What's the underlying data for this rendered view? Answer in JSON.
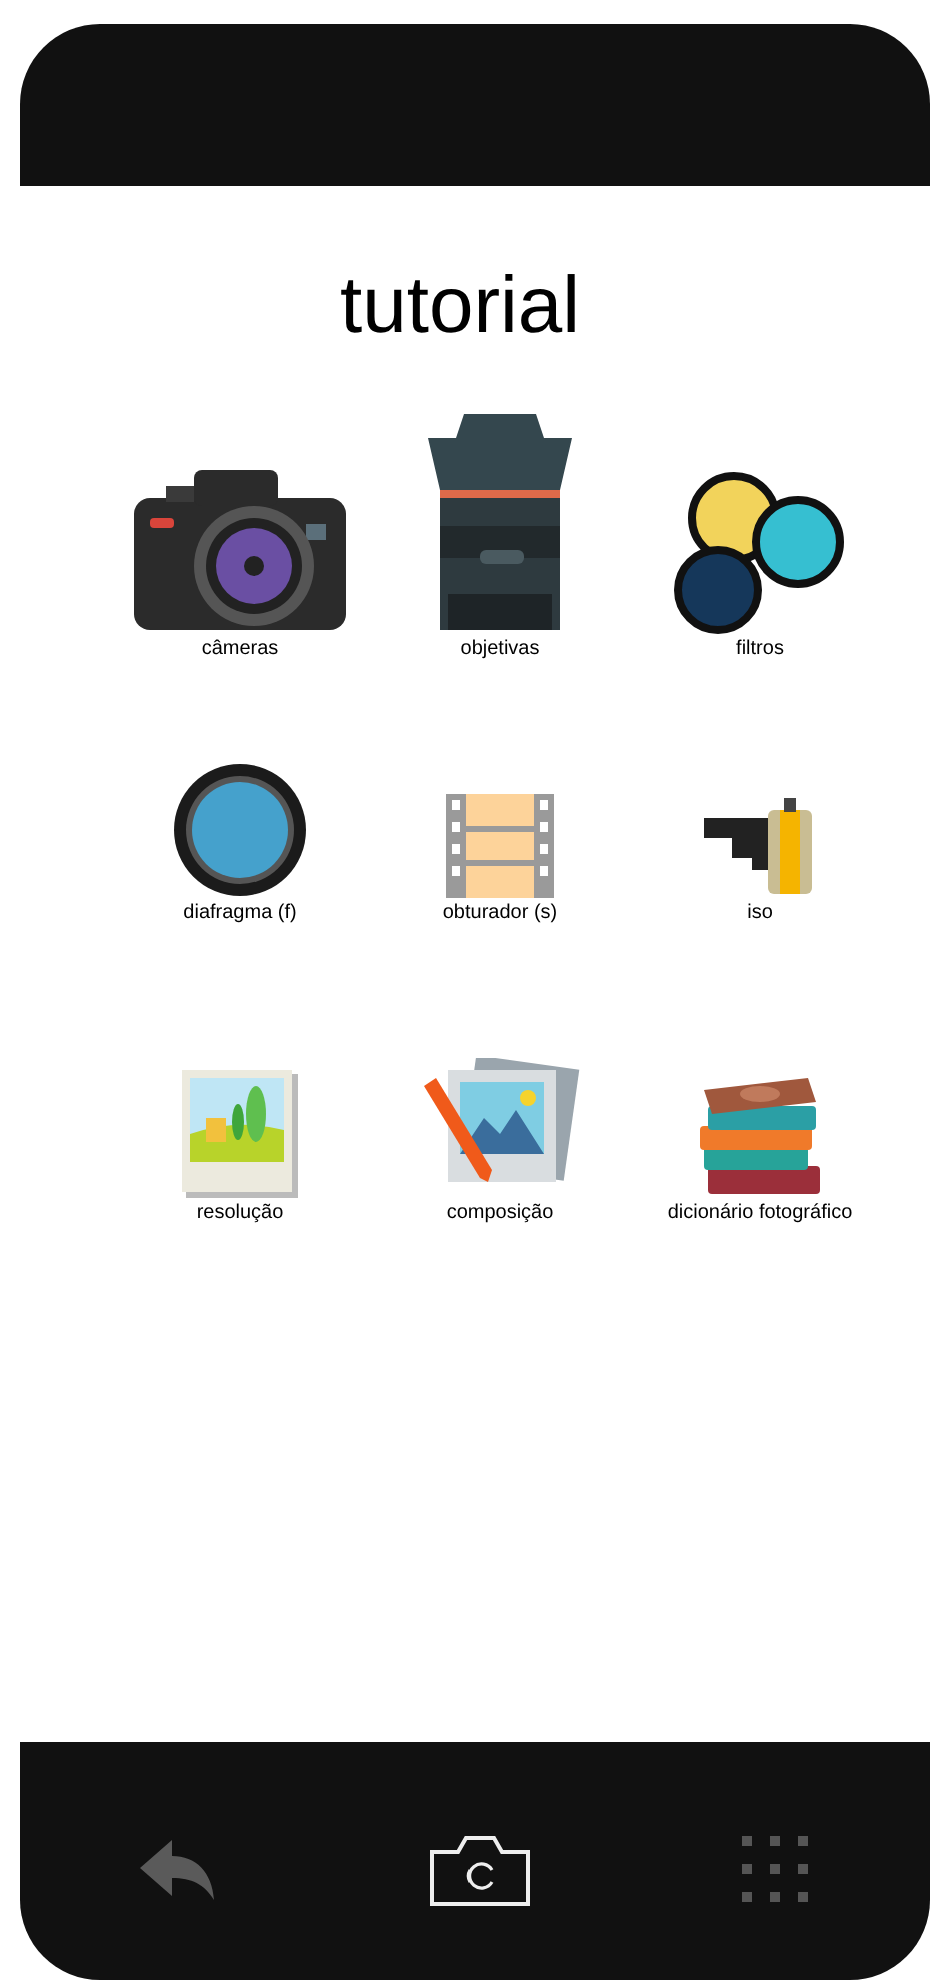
{
  "header": {
    "title": "tutorial"
  },
  "topics": [
    {
      "kind": "camera",
      "label": "câmeras"
    },
    {
      "kind": "lens",
      "label": "objetivas"
    },
    {
      "kind": "filters",
      "label": "filtros"
    },
    {
      "kind": "aperture",
      "label": "diafragma (f)"
    },
    {
      "kind": "filmstrip",
      "label": "obturador (s)"
    },
    {
      "kind": "filmroll",
      "label": "iso"
    },
    {
      "kind": "landscape",
      "label": "resolução"
    },
    {
      "kind": "composition",
      "label": "composição"
    },
    {
      "kind": "books",
      "label": "dicionário fotográfico"
    }
  ]
}
